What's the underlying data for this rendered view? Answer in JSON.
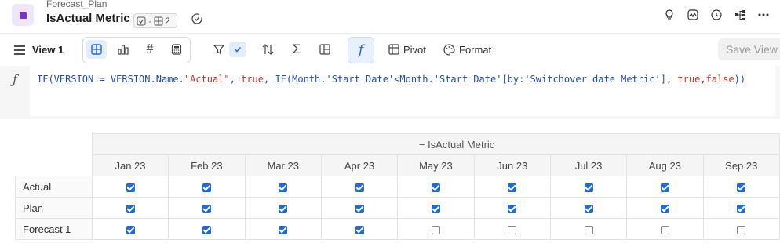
{
  "header": {
    "breadcrumb": "Forecast_Plan",
    "title": "IsActual Metric",
    "chip_count": "2"
  },
  "toolbar": {
    "view_label": "View 1",
    "pivot_label": "Pivot",
    "format_label": "Format",
    "save_label": "Save View"
  },
  "formula": {
    "p1": "IF(VERSION = VERSION.Name.",
    "p2": "\"Actual\"",
    "p3": ", ",
    "p4": "true",
    "p5": ", IF(Month.'Start Date'<Month.'Start Date'[by:'Switchover date Metric'], ",
    "p6": "true",
    "p7": ",",
    "p8": "false",
    "p9": "))"
  },
  "grid": {
    "metric_header": "IsActual Metric",
    "columns": [
      "Jan 23",
      "Feb 23",
      "Mar 23",
      "Apr 23",
      "May 23",
      "Jun 23",
      "Jul 23",
      "Aug 23",
      "Sep 23"
    ],
    "rows": [
      {
        "label": "Actual",
        "values": [
          true,
          true,
          true,
          true,
          true,
          true,
          true,
          true,
          true
        ]
      },
      {
        "label": "Plan",
        "values": [
          true,
          true,
          true,
          true,
          true,
          true,
          true,
          true,
          true
        ]
      },
      {
        "label": "Forecast 1",
        "values": [
          true,
          true,
          true,
          true,
          false,
          false,
          false,
          false,
          false
        ]
      }
    ]
  }
}
